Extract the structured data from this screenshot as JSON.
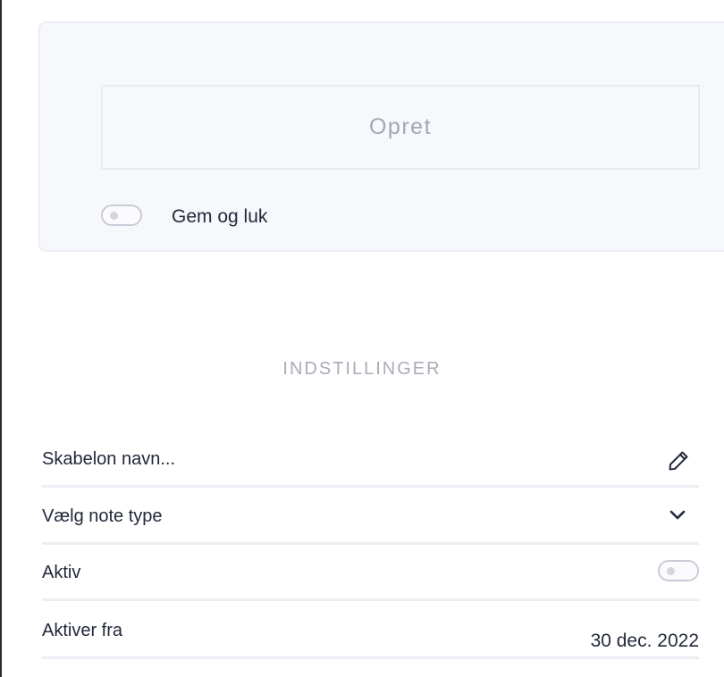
{
  "card": {
    "create_button_label": "Opret",
    "save_and_close_label": "Gem og luk",
    "save_and_close_enabled": false
  },
  "settings": {
    "heading": "INDSTILLINGER",
    "template_name_placeholder": "Skabelon navn...",
    "note_type_placeholder": "Vælg note type",
    "active_label": "Aktiv",
    "active_enabled": false,
    "activate_from_label": "Aktiver fra",
    "activate_from_value": "30 dec. 2022"
  },
  "icons": {
    "edit": "pencil-icon",
    "dropdown": "chevron-down-icon"
  },
  "colors": {
    "card_bg": "#f7f8fc",
    "muted_text": "#a3a7b3",
    "text": "#23283a",
    "divider": "#eceef4"
  }
}
